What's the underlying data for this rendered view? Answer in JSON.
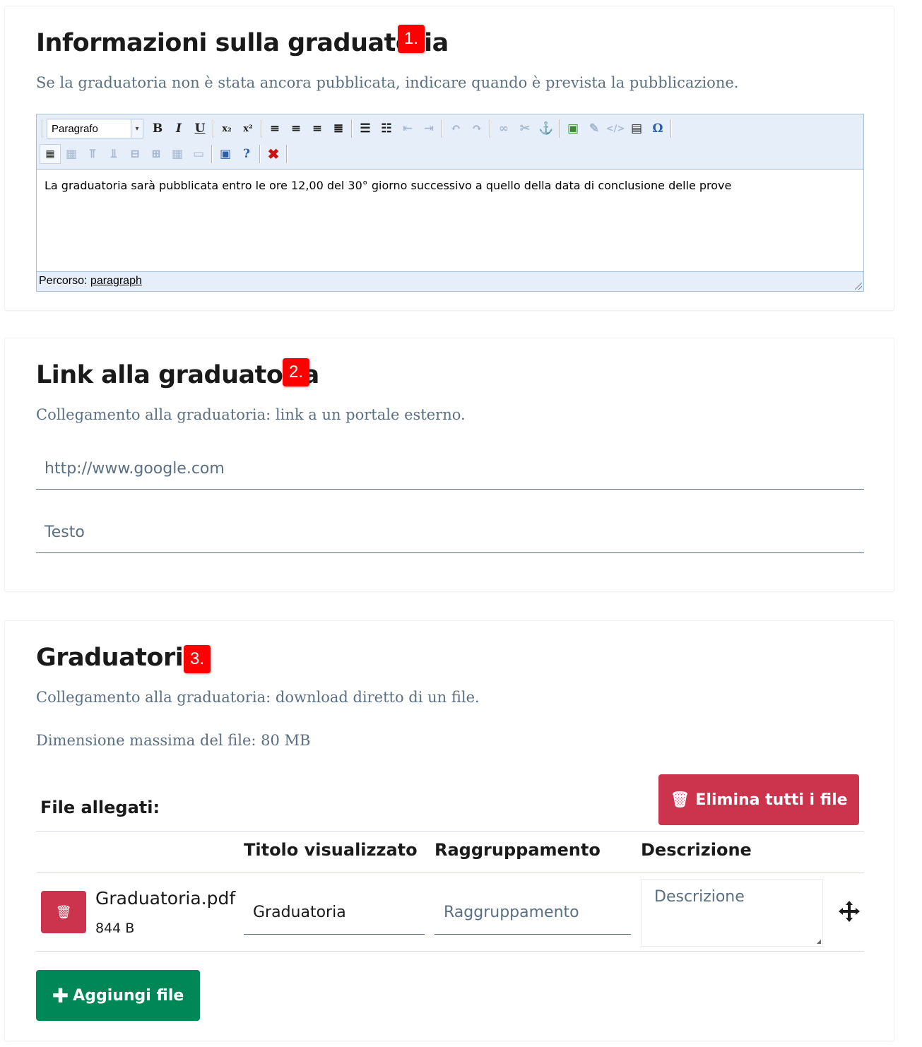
{
  "section1": {
    "title": "Informazioni sulla graduatoria",
    "badge": "1.",
    "description": "Se la graduatoria non è stata ancora pubblicata, indicare quando è prevista la pubblicazione.",
    "editor": {
      "format_select": "Paragrafo",
      "content": "La graduatoria sarà pubblicata entro le ore 12,00 del 30° giorno successivo a quello della data di conclusione delle prove",
      "status_label": "Percorso:",
      "status_path": "paragraph"
    }
  },
  "section2": {
    "title": "Link alla graduatoria",
    "badge": "2.",
    "description": "Collegamento alla graduatoria: link a un portale esterno.",
    "url_placeholder": "http://www.google.com",
    "text_placeholder": "Testo"
  },
  "section3": {
    "title": "Graduatoria",
    "badge": "3.",
    "description": "Collegamento alla graduatoria: download diretto di un file.",
    "max_size": "Dimensione massima del file: 80 MB",
    "attachments_label": "File allegati:",
    "delete_all_label": "Elimina tutti i file",
    "columns": [
      "Titolo visualizzato",
      "Raggruppamento",
      "Descrizione"
    ],
    "files": [
      {
        "name": "Graduatoria.pdf",
        "size": "844 B",
        "title_value": "Graduatoria",
        "group_placeholder": "Raggruppamento",
        "description_placeholder": "Descrizione"
      }
    ],
    "add_file_label": "Aggiungi file"
  },
  "colors": {
    "badge": "#ff0000",
    "danger": "#cc334d",
    "success": "#008758",
    "muted_text": "#5b6f82"
  }
}
